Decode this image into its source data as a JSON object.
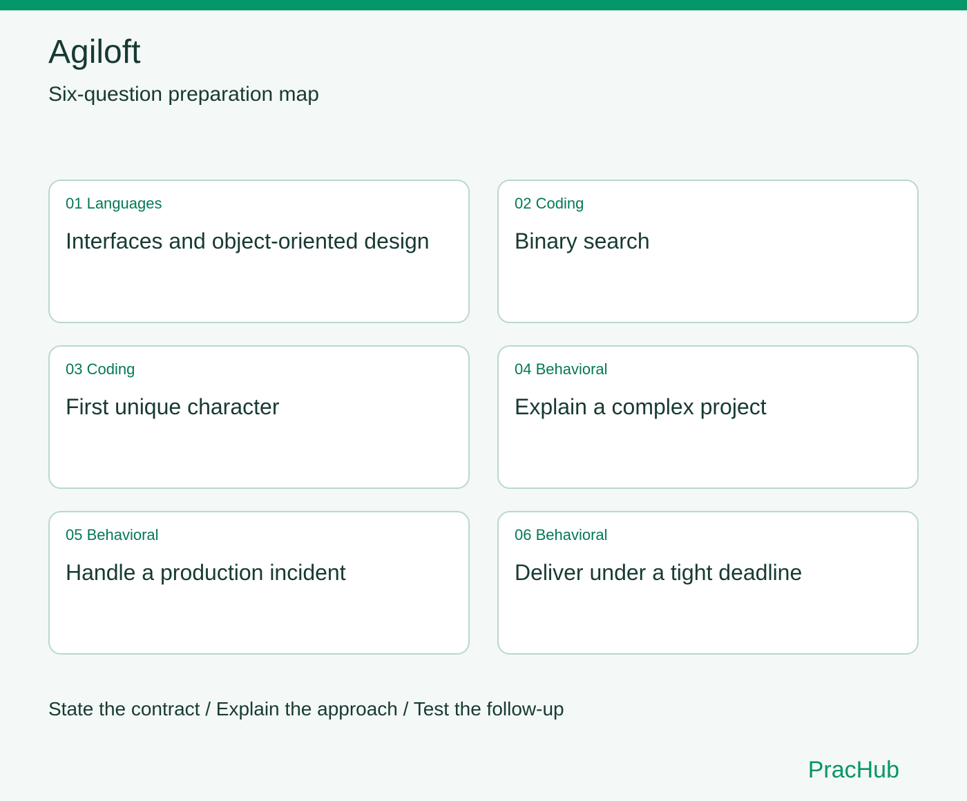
{
  "header": {
    "company": "Agiloft",
    "subtitle": "Six-question preparation map"
  },
  "cards": [
    {
      "tag": "01 Languages",
      "title": "Interfaces and object-oriented design"
    },
    {
      "tag": "02 Coding",
      "title": "Binary search"
    },
    {
      "tag": "03 Coding",
      "title": "First unique character"
    },
    {
      "tag": "04 Behavioral",
      "title": "Explain a complex project"
    },
    {
      "tag": "05 Behavioral",
      "title": "Handle a production incident"
    },
    {
      "tag": "06 Behavioral",
      "title": "Deliver under a tight deadline"
    }
  ],
  "footer": {
    "note": "State the contract / Explain the approach / Test the follow-up",
    "brand": "PracHub"
  },
  "colors": {
    "accent": "#059669",
    "tag": "#047857",
    "text": "#173a33",
    "card_border": "#b9d8cd",
    "background": "#f4f8f6"
  }
}
